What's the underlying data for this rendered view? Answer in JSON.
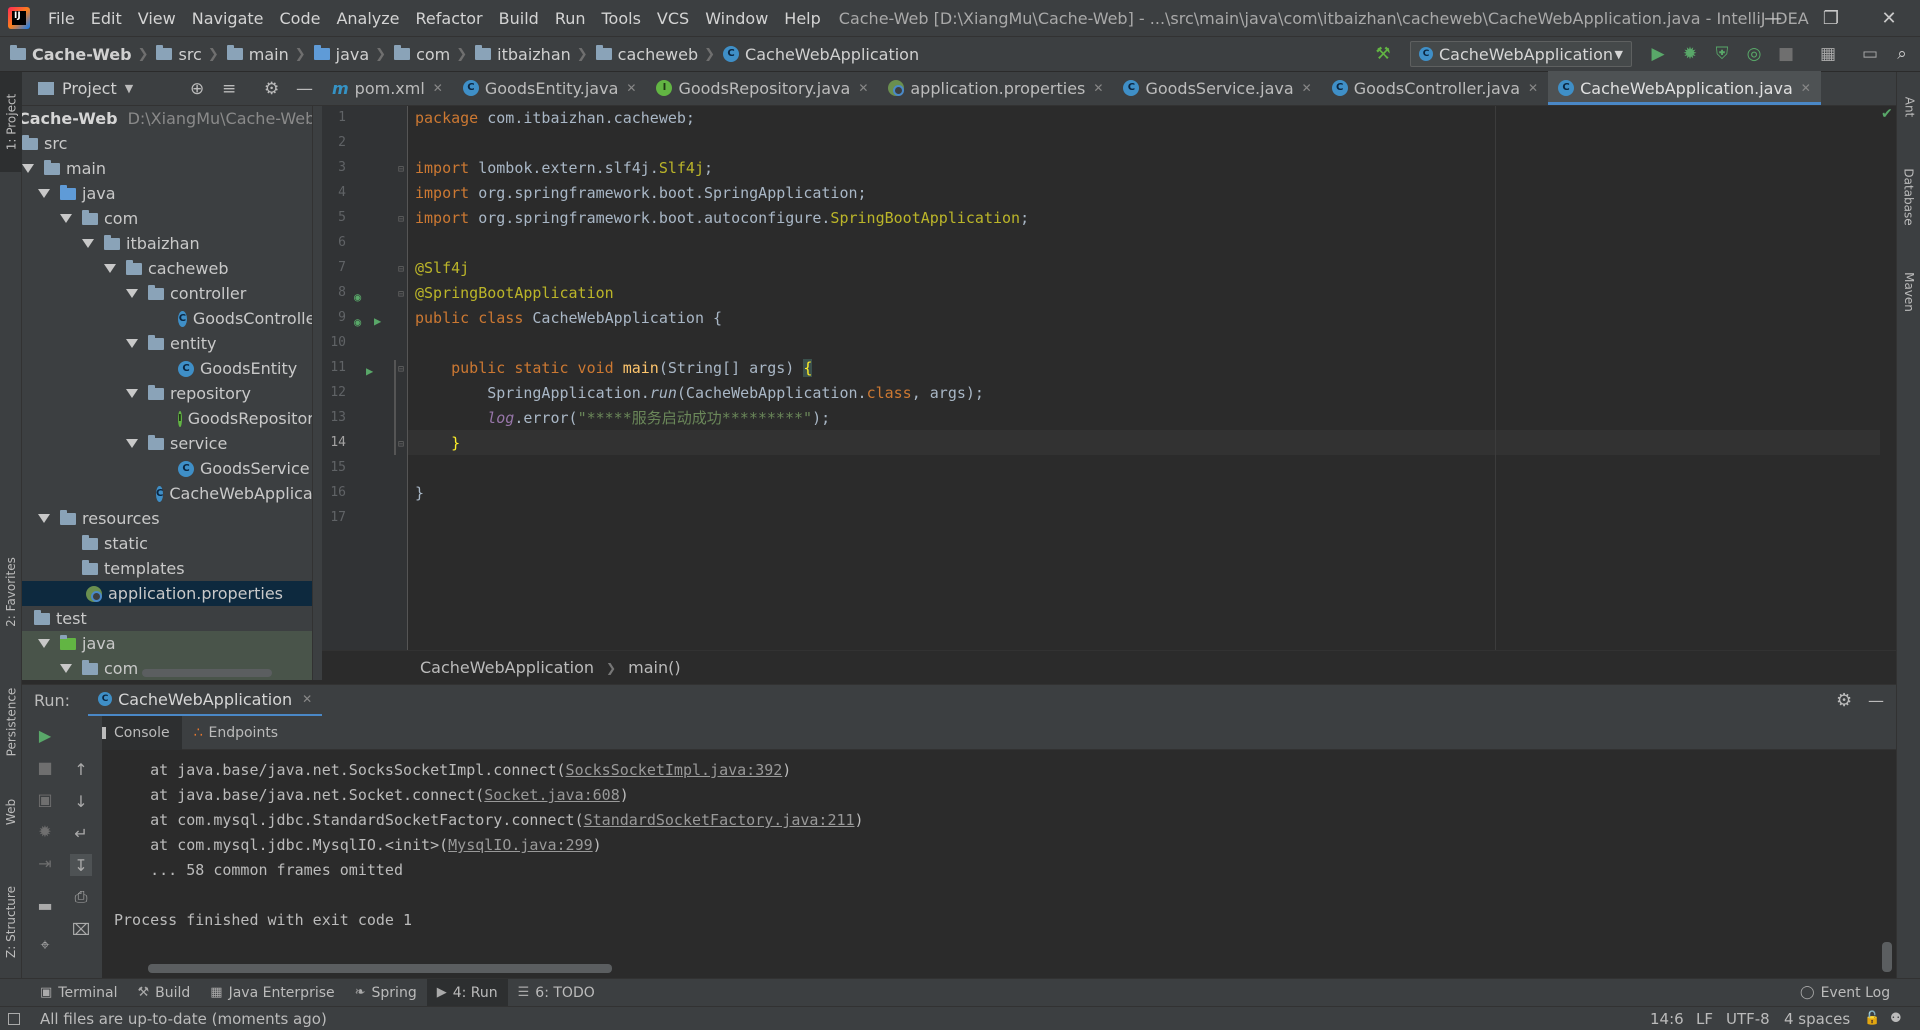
{
  "menubar": {
    "logo_text": "IJ",
    "items": [
      "File",
      "Edit",
      "View",
      "Navigate",
      "Code",
      "Analyze",
      "Refactor",
      "Build",
      "Run",
      "Tools",
      "VCS",
      "Window",
      "Help"
    ],
    "window_title": "Cache-Web [D:\\XiangMu\\Cache-Web] - ...\\src\\main\\java\\com\\itbaizhan\\cacheweb\\CacheWebApplication.java - IntelliJ IDEA"
  },
  "navbar": {
    "project": "Cache-Web",
    "crumbs": [
      "src",
      "main",
      "java",
      "com",
      "itbaizhan",
      "cacheweb",
      "CacheWebApplication"
    ],
    "run_config": "CacheWebApplication"
  },
  "left_stripe": {
    "project": "1: Project",
    "favorites": "2: Favorites",
    "persistence": "Persistence",
    "web": "Web",
    "structure": "Z: Structure"
  },
  "right_stripe": {
    "ant": "Ant",
    "database": "Database",
    "maven": "Maven"
  },
  "project_panel": {
    "title": "Project",
    "root_name": "Cache-Web",
    "root_path": "D:\\XiangMu\\Cache-Web",
    "tree": [
      {
        "label": "src",
        "type": "folder"
      },
      {
        "label": "main",
        "type": "folder"
      },
      {
        "label": "java",
        "type": "folder-blue"
      },
      {
        "label": "com",
        "type": "folder"
      },
      {
        "label": "itbaizhan",
        "type": "folder"
      },
      {
        "label": "cacheweb",
        "type": "folder"
      },
      {
        "label": "controller",
        "type": "folder"
      },
      {
        "label": "GoodsController",
        "type": "class"
      },
      {
        "label": "entity",
        "type": "folder"
      },
      {
        "label": "GoodsEntity",
        "type": "class"
      },
      {
        "label": "repository",
        "type": "folder"
      },
      {
        "label": "GoodsRepository",
        "type": "interface"
      },
      {
        "label": "service",
        "type": "folder"
      },
      {
        "label": "GoodsService",
        "type": "class"
      },
      {
        "label": "CacheWebApplication",
        "type": "class"
      },
      {
        "label": "resources",
        "type": "folder"
      },
      {
        "label": "static",
        "type": "folder"
      },
      {
        "label": "templates",
        "type": "folder"
      },
      {
        "label": "application.properties",
        "type": "props"
      },
      {
        "label": "test",
        "type": "folder"
      },
      {
        "label": "java",
        "type": "folder-green"
      },
      {
        "label": "com",
        "type": "folder"
      }
    ]
  },
  "editor_tabs": [
    {
      "label": "pom.xml",
      "icon": "maven-icon"
    },
    {
      "label": "GoodsEntity.java",
      "icon": "class-icon"
    },
    {
      "label": "GoodsRepository.java",
      "icon": "interface-icon"
    },
    {
      "label": "application.properties",
      "icon": "properties-icon"
    },
    {
      "label": "GoodsService.java",
      "icon": "class-icon"
    },
    {
      "label": "GoodsController.java",
      "icon": "class-icon"
    },
    {
      "label": "CacheWebApplication.java",
      "icon": "spring-class-icon",
      "active": true
    }
  ],
  "editor": {
    "line_numbers": [
      "1",
      "2",
      "3",
      "4",
      "5",
      "6",
      "7",
      "8",
      "9",
      "10",
      "11",
      "12",
      "13",
      "14",
      "15",
      "16",
      "17"
    ],
    "current_line": "14",
    "breadcrumb_class": "CacheWebApplication",
    "breadcrumb_method": "main()",
    "code": {
      "l1_kw": "package",
      "l1_rest": " com.itbaizhan.cacheweb;",
      "l3_kw": "import",
      "l3_rest": " lombok.extern.slf4j.",
      "l3_cls": "Slf4j",
      "l3_end": ";",
      "l4_kw": "import",
      "l4_rest": " org.springframework.boot.SpringApplication;",
      "l5_kw": "import",
      "l5_rest": " org.springframework.boot.autoconfigure.",
      "l5_cls": "SpringBootApplication",
      "l5_end": ";",
      "l7": "@Slf4j",
      "l8": "@SpringBootApplication",
      "l9_kw": "public class",
      "l9_rest": " CacheWebApplication {",
      "l11_kw": "    public static void",
      "l11_fn": " main",
      "l11_rest": "(String[] args) ",
      "l11_brace": "{",
      "l12_pre": "        SpringApplication.",
      "l12_fn": "run",
      "l12_mid": "(CacheWebApplication.",
      "l12_kw": "class",
      "l12_end": ", args);",
      "l13_pre": "        ",
      "l13_log": "log",
      "l13_mid": ".error(",
      "l13_str": "\"*****服务启动成功*********\"",
      "l13_end": ");",
      "l14": "    }",
      "l16": "}"
    }
  },
  "run_panel": {
    "label": "Run:",
    "tab": "CacheWebApplication",
    "console_tab": "Console",
    "endpoints_tab": "Endpoints",
    "lines": [
      {
        "pre": "    at java.base/java.net.SocksSocketImpl.connect(",
        "link": "SocksSocketImpl.java:392",
        "post": ")"
      },
      {
        "pre": "    at java.base/java.net.Socket.connect(",
        "link": "Socket.java:608",
        "post": ")"
      },
      {
        "pre": "    at com.mysql.jdbc.StandardSocketFactory.connect(",
        "link": "StandardSocketFactory.java:211",
        "post": ")"
      },
      {
        "pre": "    at com.mysql.jdbc.MysqlIO.<init>(",
        "link": "MysqlIO.java:299",
        "post": ")"
      },
      {
        "pre": "    ... 58 common frames omitted",
        "link": "",
        "post": ""
      },
      {
        "pre": "",
        "link": "",
        "post": ""
      },
      {
        "pre": "Process finished with exit code 1",
        "link": "",
        "post": ""
      }
    ]
  },
  "bottom_tabs": [
    {
      "label": "Terminal",
      "icon": "terminal-icon"
    },
    {
      "label": "Build",
      "icon": "hammer-icon"
    },
    {
      "label": "Java Enterprise",
      "icon": "enterprise-icon"
    },
    {
      "label": "Spring",
      "icon": "spring-icon"
    },
    {
      "label": "4: Run",
      "icon": "run-icon",
      "active": true
    },
    {
      "label": "6: TODO",
      "icon": "todo-icon"
    }
  ],
  "event_log": "Event Log",
  "status": {
    "message": "All files are up-to-date (moments ago)",
    "position": "14:6",
    "line_sep": "LF",
    "encoding": "UTF-8",
    "indent": "4 spaces"
  }
}
